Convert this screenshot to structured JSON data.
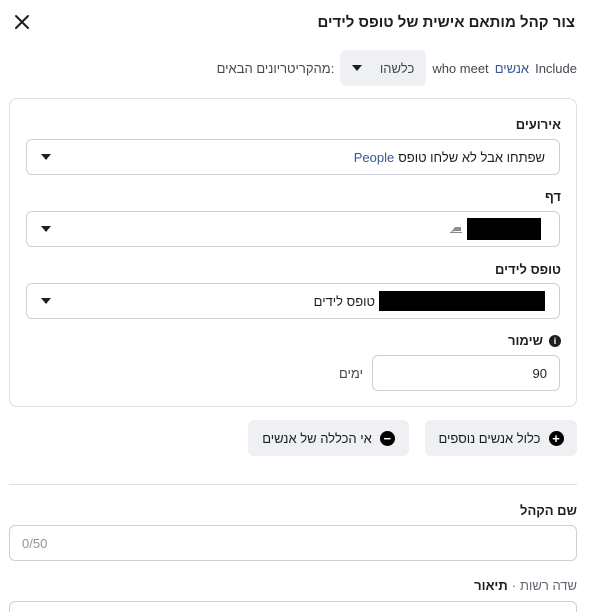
{
  "header": {
    "title": "צור קהל מותאם אישית של טופס לידים"
  },
  "include_row": {
    "include_text": "Include",
    "people_text": "אנשים",
    "who_meet_text": "who meet",
    "dropdown_value": "כלשהו",
    "suffix_text": "מהקריטריונים הבאים:"
  },
  "events": {
    "label": "אירועים",
    "value_prefix": "People",
    "value_text": "שפתחו אבל לא שלחו טופס"
  },
  "page": {
    "label": "דף"
  },
  "lead_form": {
    "label": "טופס לידים",
    "value_prefix": "טופס לידים"
  },
  "retention": {
    "label": "שימור",
    "value": "90",
    "unit": "ימים"
  },
  "buttons": {
    "include_more": "כלול אנשים נוספים",
    "exclude": "אי הכללה של אנשים"
  },
  "audience_name": {
    "label": "שם הקהל",
    "counter": "0/50"
  },
  "description": {
    "label": "תיאור",
    "separator": "·",
    "optional": "שדה רשות"
  },
  "icons": {
    "close": "close-icon",
    "caret": "caret-down-icon",
    "info": "info-icon",
    "plus": "plus-circle-icon",
    "minus": "minus-circle-icon",
    "page": "page-flag-icon"
  },
  "colors": {
    "link_blue": "#385898",
    "button_bg": "#eef0f3",
    "border": "#ccd0d5"
  }
}
